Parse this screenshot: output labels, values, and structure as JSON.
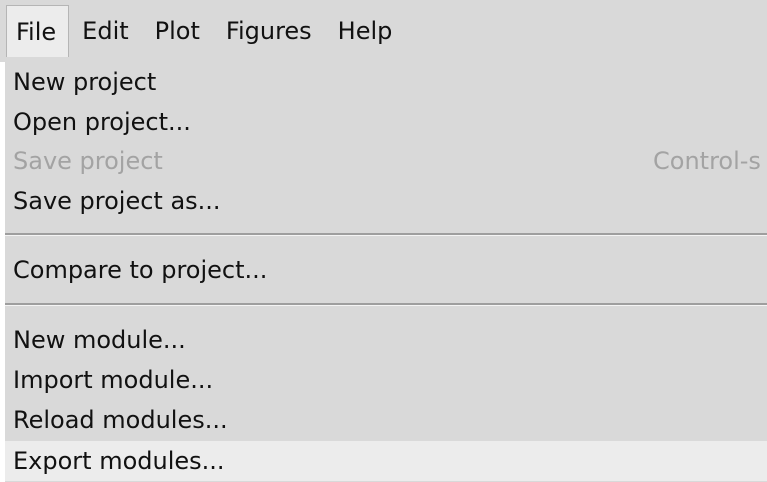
{
  "menubar": {
    "items": [
      {
        "label": "File"
      },
      {
        "label": "Edit"
      },
      {
        "label": "Plot"
      },
      {
        "label": "Figures"
      },
      {
        "label": "Help"
      }
    ]
  },
  "file_menu": {
    "new_project": "New project",
    "open_project": "Open project...",
    "save_project": "Save project",
    "save_project_shortcut": "Control-s",
    "save_project_as": "Save project as...",
    "compare_to_project": "Compare to project...",
    "new_module": "New module...",
    "import_module": "Import module...",
    "reload_modules": "Reload modules...",
    "export_modules": "Export modules..."
  }
}
